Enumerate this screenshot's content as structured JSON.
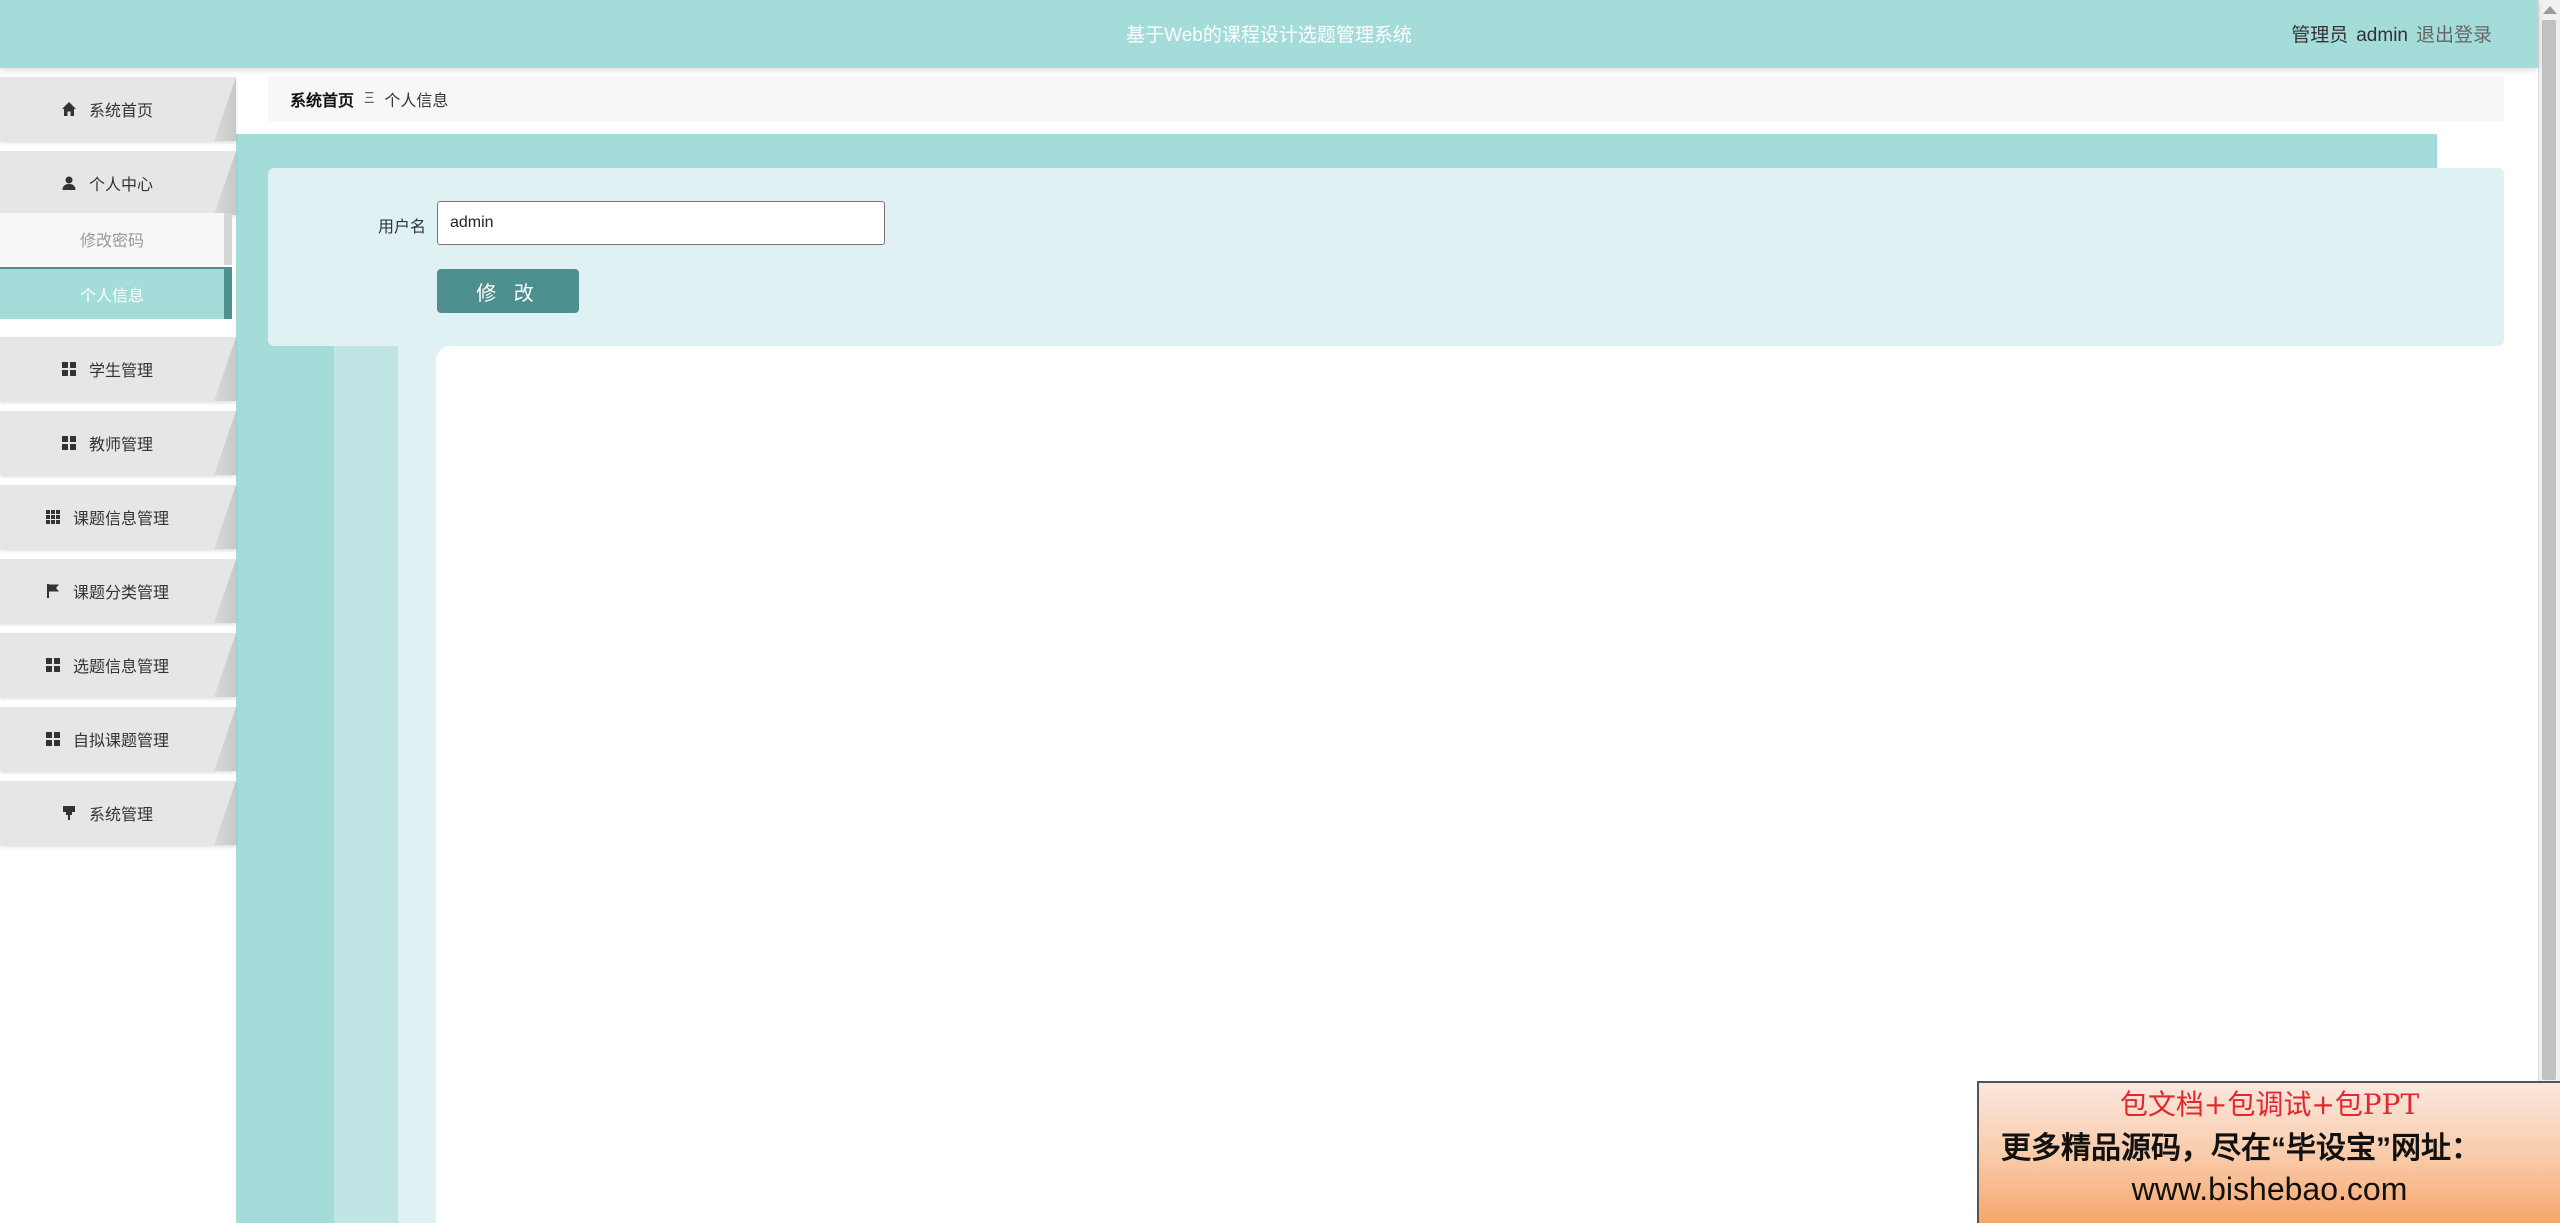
{
  "header": {
    "title": "基于Web的课程设计选题管理系统",
    "role": "管理员",
    "username": "admin",
    "logout_label": "退出登录"
  },
  "sidebar": {
    "items": [
      {
        "label": "系统首页",
        "icon": "home-icon"
      },
      {
        "label": "个人中心",
        "icon": "user-icon"
      },
      {
        "label": "学生管理",
        "icon": "grid-icon"
      },
      {
        "label": "教师管理",
        "icon": "grid-icon"
      },
      {
        "label": "课题信息管理",
        "icon": "apps-icon"
      },
      {
        "label": "课题分类管理",
        "icon": "flag-icon"
      },
      {
        "label": "选题信息管理",
        "icon": "grid-icon"
      },
      {
        "label": "自拟课题管理",
        "icon": "grid-icon"
      },
      {
        "label": "系统管理",
        "icon": "pin-icon"
      }
    ],
    "subitems": [
      {
        "label": "修改密码"
      },
      {
        "label": "个人信息"
      }
    ]
  },
  "breadcrumb": {
    "home": "系统首页",
    "separator": "Ξ",
    "current": "个人信息"
  },
  "form": {
    "username_label": "用户名",
    "username_value": "admin",
    "submit_label": "修 改"
  },
  "promo": {
    "line1": "包文档+包调试+包PPT",
    "line2": "更多精品源码，尽在“毕设宝”网址：",
    "line3": "www.bishebao.com"
  },
  "colors": {
    "header": "#a4dcd9",
    "accent": "#4e8f8f",
    "panel": "#dff1f2"
  }
}
